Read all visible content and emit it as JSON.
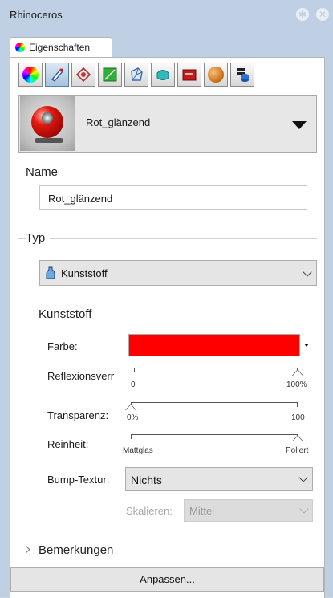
{
  "window": {
    "title": "Rhinoceros",
    "settings_icon": "gear-icon",
    "close_icon": "close-icon"
  },
  "tab": {
    "label": "Eigenschaften",
    "icon": "color-wheel-icon"
  },
  "toolbar": {
    "buttons": [
      {
        "icon": "color-wheel-icon"
      },
      {
        "icon": "material-brush-icon"
      },
      {
        "icon": "decal-icon"
      },
      {
        "icon": "texture-mapping-icon"
      },
      {
        "icon": "render-mesh-icon"
      },
      {
        "icon": "subdivision-icon"
      },
      {
        "icon": "box-object-icon"
      },
      {
        "icon": "environment-sphere-icon"
      },
      {
        "icon": "layer-stack-icon"
      }
    ]
  },
  "material": {
    "name": "Rot_glänzend",
    "thumbnail_icon": "material-preview-icon"
  },
  "name_section": {
    "label": "Name",
    "value": "Rot_glänzend"
  },
  "type_section": {
    "label": "Typ",
    "value": "Kunststoff",
    "icon": "plastic-bottle-icon"
  },
  "kunststoff_section": {
    "label": "Kunststoff",
    "farbe": {
      "label": "Farbe:",
      "color": "#ff0000"
    },
    "reflexion": {
      "label": "Reflexionsverr",
      "min_label": "0",
      "max_label": "100%",
      "value": 1.0
    },
    "transparenz": {
      "label": "Transparenz:",
      "min_label": "0%",
      "max_label": "100",
      "value": 0.0
    },
    "reinheit": {
      "label": "Reinheit:",
      "min_label": "Mattglas",
      "max_label": "Poliert",
      "value": 1.0
    },
    "bump": {
      "label": "Bump-Textur:",
      "value": "Nichts"
    },
    "skalieren": {
      "label": "Skalieren:",
      "value": "Mittel"
    }
  },
  "notes_section": {
    "label": "Bemerkungen"
  },
  "customize_button": {
    "label": "Anpassen..."
  }
}
